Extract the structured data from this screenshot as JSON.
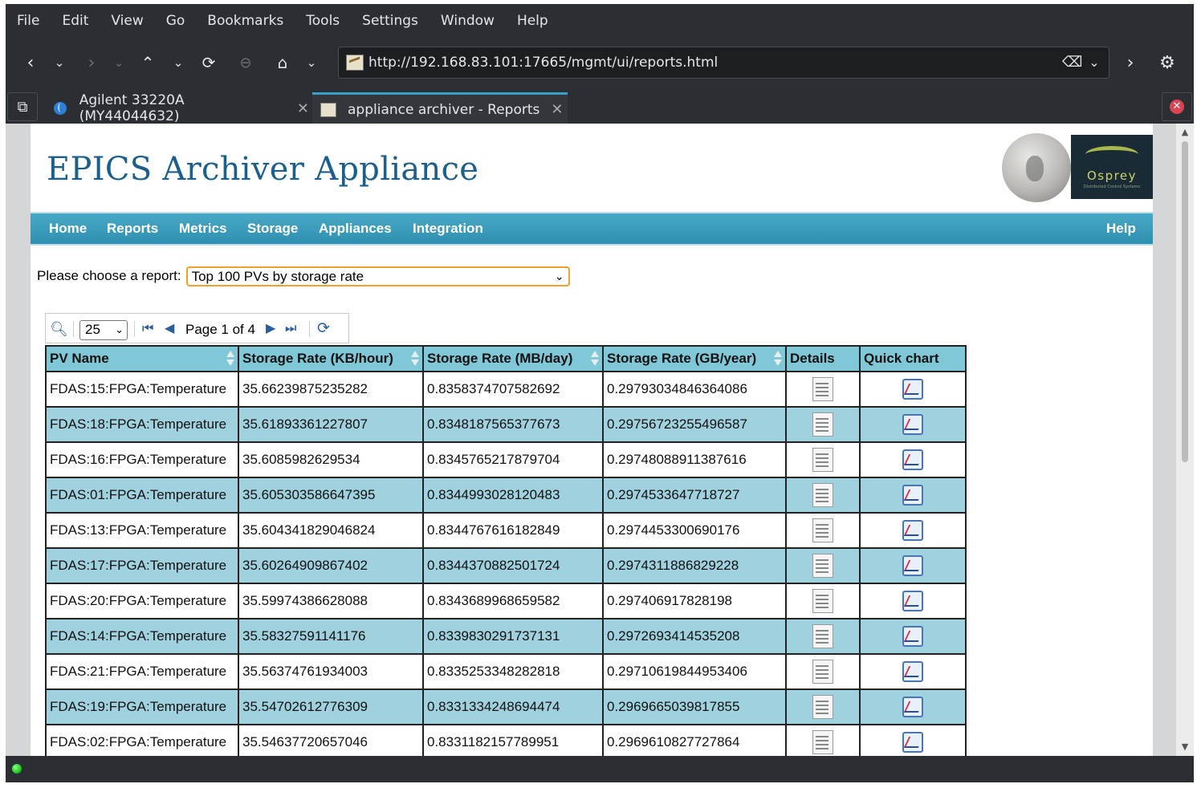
{
  "menubar": [
    "File",
    "Edit",
    "View",
    "Go",
    "Bookmarks",
    "Tools",
    "Settings",
    "Window",
    "Help"
  ],
  "address": {
    "url": "http://192.168.83.101:17665/mgmt/ui/reports.html"
  },
  "tabs": [
    {
      "title": "Agilent 33220A (MY44044632)",
      "icon": "globe-icon"
    },
    {
      "title": "appliance archiver - Reports",
      "icon": "site-favicon"
    }
  ],
  "header": {
    "title": "EPICS Archiver Appliance",
    "logo_text": "Osprey",
    "logo_sub": "Distributed Control Systems"
  },
  "nav": {
    "items": [
      "Home",
      "Reports",
      "Metrics",
      "Storage",
      "Appliances",
      "Integration"
    ],
    "help": "Help"
  },
  "chooser": {
    "label": "Please choose a report:",
    "selected": "Top 100 PVs by storage rate"
  },
  "pager": {
    "page_size": "25",
    "page_info": "Page 1 of 4"
  },
  "table": {
    "columns": [
      "PV Name",
      "Storage Rate (KB/hour)",
      "Storage Rate (MB/day)",
      "Storage Rate (GB/year)",
      "Details",
      "Quick chart"
    ],
    "rows": [
      [
        "FDAS:15:FPGA:Temperature",
        "35.66239875235282",
        "0.8358374707582692",
        "0.29793034846364086"
      ],
      [
        "FDAS:18:FPGA:Temperature",
        "35.61893361227807",
        "0.8348187565377673",
        "0.29756723255496587"
      ],
      [
        "FDAS:16:FPGA:Temperature",
        "35.6085982629534",
        "0.8345765217879704",
        "0.29748088911387616"
      ],
      [
        "FDAS:01:FPGA:Temperature",
        "35.605303586647395",
        "0.8344993028120483",
        "0.2974533647718727"
      ],
      [
        "FDAS:13:FPGA:Temperature",
        "35.604341829046824",
        "0.8344767616182849",
        "0.2974453300690176"
      ],
      [
        "FDAS:17:FPGA:Temperature",
        "35.60264909867402",
        "0.8344370882501724",
        "0.2974311886829228"
      ],
      [
        "FDAS:20:FPGA:Temperature",
        "35.59974386628088",
        "0.8343689968659582",
        "0.297406917828198"
      ],
      [
        "FDAS:14:FPGA:Temperature",
        "35.58327591141176",
        "0.8339830291737131",
        "0.2972693414535208"
      ],
      [
        "FDAS:21:FPGA:Temperature",
        "35.56374761934003",
        "0.8335253348282818",
        "0.29710619844953406"
      ],
      [
        "FDAS:19:FPGA:Temperature",
        "35.54702612776309",
        "0.8331334248694474",
        "0.2969665039817855"
      ],
      [
        "FDAS:02:FPGA:Temperature",
        "35.54637720657046",
        "0.8331182157789951",
        "0.2969610827727864"
      ]
    ]
  },
  "colors": {
    "title": "#1b5f8c",
    "nav": "#2f8fb0",
    "row_alt": "#9fd1df",
    "header_row": "#80c7d8",
    "select_focus": "#f0a030"
  }
}
